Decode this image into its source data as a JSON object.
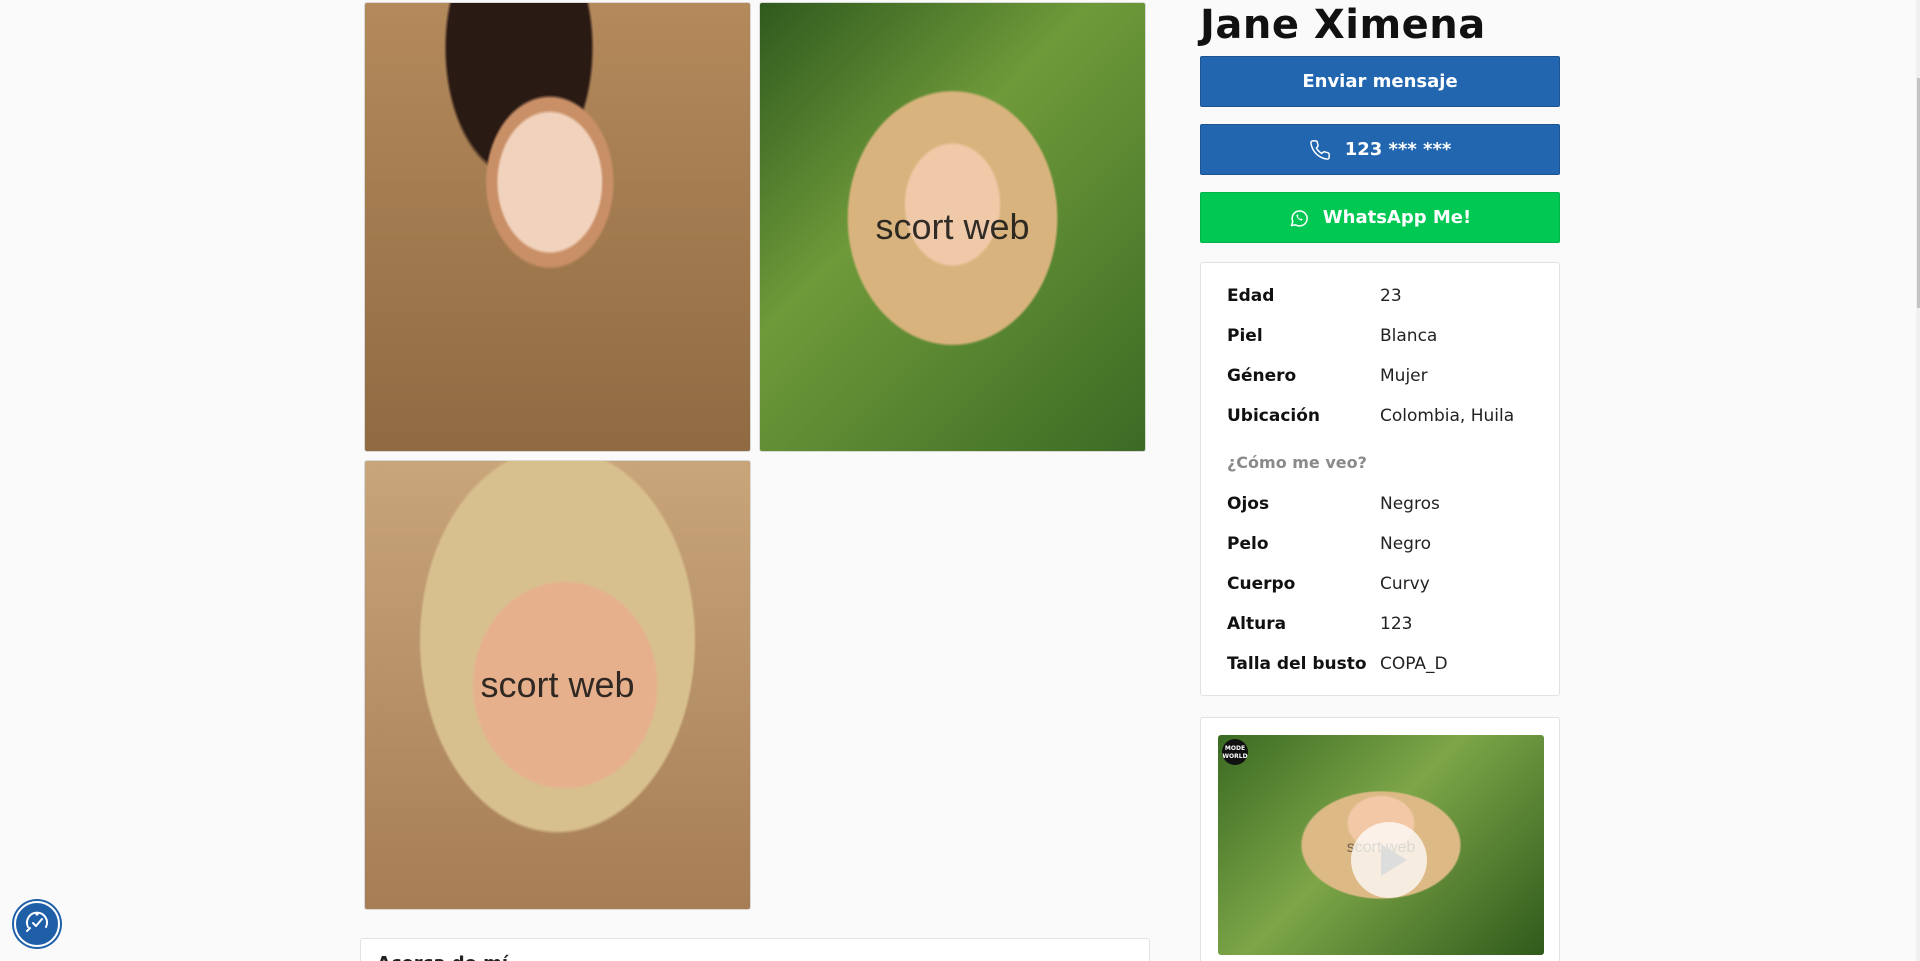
{
  "profile": {
    "name": "Jane Ximena"
  },
  "gallery": {
    "watermark": "scort web",
    "photos": [
      {
        "alt": "profile-photo-1"
      },
      {
        "alt": "profile-photo-2"
      },
      {
        "alt": "profile-photo-3"
      }
    ]
  },
  "about": {
    "heading": "Acerca de mí"
  },
  "actions": {
    "message_label": "Enviar mensaje",
    "phone_label": "123 *** ***",
    "whatsapp_label": "WhatsApp Me!",
    "icons": {
      "phone": "phone-icon",
      "whatsapp": "whatsapp-icon"
    },
    "colors": {
      "primary": "#2266b0",
      "whatsapp": "#00c853"
    }
  },
  "details": {
    "basic": [
      {
        "label": "Edad",
        "value": "23"
      },
      {
        "label": "Piel",
        "value": "Blanca"
      },
      {
        "label": "Género",
        "value": "Mujer"
      },
      {
        "label": "Ubicación",
        "value": "Colombia, Huila"
      }
    ],
    "appearance_heading": "¿Cómo me veo?",
    "appearance": [
      {
        "label": "Ojos",
        "value": "Negros"
      },
      {
        "label": "Pelo",
        "value": "Negro"
      },
      {
        "label": "Cuerpo",
        "value": "Curvy"
      },
      {
        "label": "Altura",
        "value": "123"
      },
      {
        "label": "Talla del busto",
        "value": "COPA_D"
      }
    ]
  },
  "video": {
    "watermark": "scort web",
    "brand_badge": "MODE WORLD",
    "icon": "play-icon"
  },
  "accessibility": {
    "icon": "accessibility-icon"
  }
}
